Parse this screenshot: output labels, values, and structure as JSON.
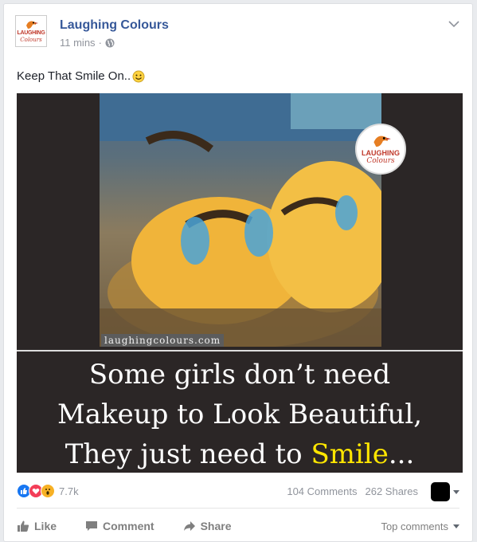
{
  "post": {
    "page_name": "Laughing Colours",
    "time": "11 mins",
    "meta_separator": "·",
    "text": "Keep That Smile On..",
    "avatar_logo_top": "LAUGHING",
    "avatar_logo_bottom": "Colours"
  },
  "media": {
    "watermark": "laughingcolours.com",
    "badge_top": "LAUGHING",
    "badge_bottom": "Colours",
    "caption_line1": "Some girls don’t need",
    "caption_line2": "Makeup to Look Beautiful,",
    "caption_line3_prefix": "They just need to ",
    "caption_line3_highlight": "Smile",
    "caption_line3_suffix": "..."
  },
  "stats": {
    "reaction_count": "7.7k",
    "comments": "104 Comments",
    "shares": "262 Shares",
    "reaction_icons": [
      "like-icon",
      "love-icon",
      "wow-icon"
    ]
  },
  "actions": {
    "like": "Like",
    "comment": "Comment",
    "share": "Share",
    "top_comments": "Top comments"
  },
  "colors": {
    "link": "#365899",
    "muted": "#90949c",
    "highlight": "#ffe600",
    "media_bg": "#2b2626"
  }
}
